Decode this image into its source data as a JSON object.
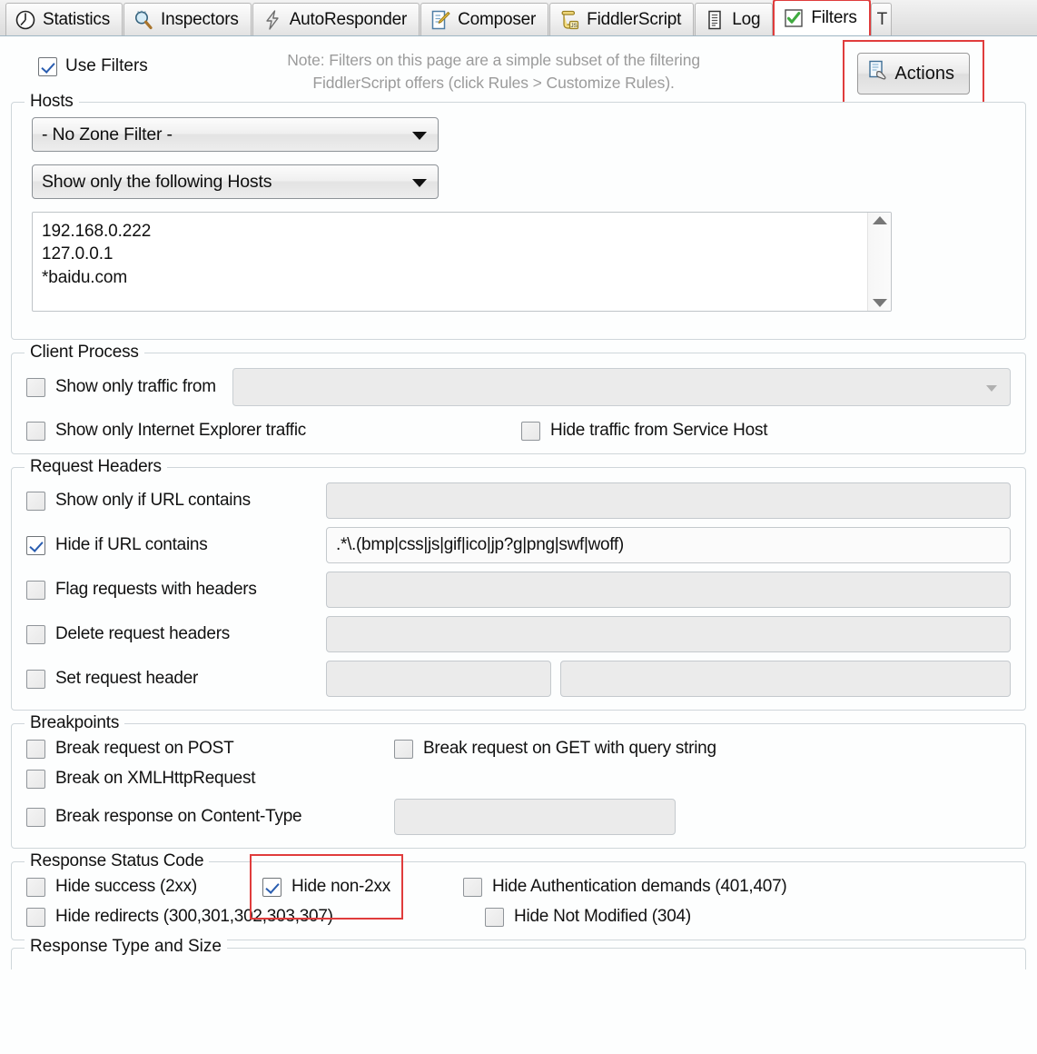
{
  "tabs": [
    {
      "label": "Statistics",
      "icon": "statistics-icon",
      "active": false
    },
    {
      "label": "Inspectors",
      "icon": "magnifier-icon",
      "active": false
    },
    {
      "label": "AutoResponder",
      "icon": "lightning-icon",
      "active": false
    },
    {
      "label": "Composer",
      "icon": "compose-pencil-icon",
      "active": false
    },
    {
      "label": "FiddlerScript",
      "icon": "js-script-icon",
      "active": false
    },
    {
      "label": "Log",
      "icon": "log-document-icon",
      "active": false
    },
    {
      "label": "Filters",
      "icon": "green-check-icon",
      "active": true
    }
  ],
  "header": {
    "use_filters_label": "Use Filters",
    "use_filters_checked": true,
    "note_line1": "Note: Filters on this page are a simple subset of the filtering",
    "note_line2": "FiddlerScript offers (click Rules > Customize Rules).",
    "actions_label": "Actions"
  },
  "hosts": {
    "legend": "Hosts",
    "zone_filter_value": "- No Zone Filter -",
    "host_filter_value": "Show only the following Hosts",
    "host_list": "192.168.0.222\n127.0.0.1\n*baidu.com"
  },
  "client_process": {
    "legend": "Client Process",
    "show_only_traffic_from_label": "Show only traffic from",
    "show_only_traffic_from_checked": false,
    "process_combo_value": "",
    "show_only_ie_label": "Show only Internet Explorer traffic",
    "show_only_ie_checked": false,
    "hide_service_host_label": "Hide traffic from Service Host",
    "hide_service_host_checked": false
  },
  "request_headers": {
    "legend": "Request Headers",
    "rows": [
      {
        "label": "Show only if URL contains",
        "checked": false,
        "value": ""
      },
      {
        "label": "Hide if URL contains",
        "checked": true,
        "value": ".*\\.(bmp|css|js|gif|ico|jp?g|png|swf|woff)"
      },
      {
        "label": "Flag requests with headers",
        "checked": false,
        "value": ""
      },
      {
        "label": "Delete request headers",
        "checked": false,
        "value": ""
      }
    ],
    "set_request_header_label": "Set request header",
    "set_request_header_checked": false,
    "set_request_header_name": "",
    "set_request_header_value": ""
  },
  "breakpoints": {
    "legend": "Breakpoints",
    "break_post_label": "Break request on POST",
    "break_post_checked": false,
    "break_xhr_label": "Break on XMLHttpRequest",
    "break_xhr_checked": false,
    "break_content_type_label": "Break response on Content-Type",
    "break_content_type_checked": false,
    "break_content_type_value": "",
    "break_get_query_label": "Break request on GET with query string",
    "break_get_query_checked": false
  },
  "response_status": {
    "legend": "Response Status Code",
    "hide_success_label": "Hide success (2xx)",
    "hide_success_checked": false,
    "hide_non2xx_label": "Hide non-2xx",
    "hide_non2xx_checked": true,
    "hide_auth_label": "Hide Authentication demands (401,407)",
    "hide_auth_checked": false,
    "hide_redirects_label": "Hide redirects (300,301,302,303,307)",
    "hide_redirects_checked": false,
    "hide_not_modified_label": "Hide Not Modified (304)",
    "hide_not_modified_checked": false
  },
  "response_type": {
    "legend": "Response Type and Size"
  },
  "colors": {
    "highlight_red": "#e03c3c",
    "check_blue": "#2a5db0",
    "check_green": "#3faa3f",
    "note_gray": "#9b9b9b"
  }
}
